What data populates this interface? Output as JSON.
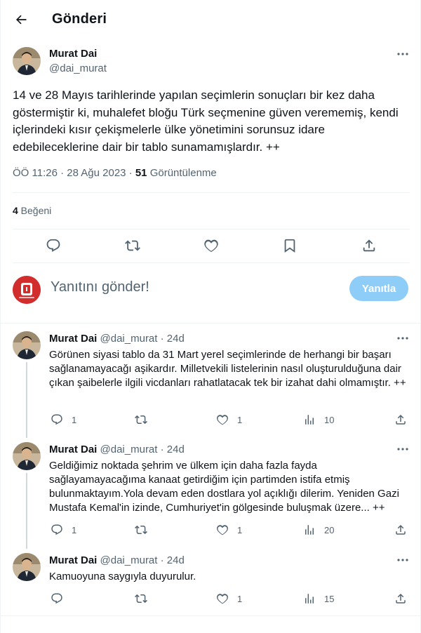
{
  "header": {
    "title": "Gönderi"
  },
  "main_post": {
    "name": "Murat Dai",
    "handle": "@dai_murat",
    "text": "14 ve 28 Mayıs tarihlerinde yapılan seçimlerin sonuçları bir kez daha göstermiştir ki, muhalefet bloğu Türk seçmenine güven verememiş, kendi içlerindeki kısır çekişmelerle ülke yönetimini sorunsuz idare edebileceklerine dair bir tablo sunamamışlardır. ++",
    "time": "ÖÖ 11:26 · 28 Ağu 2023 · ",
    "views_count": "51",
    "views_label": " Görüntülenme",
    "likes_count": "4",
    "likes_label": " Beğeni"
  },
  "reply_box": {
    "placeholder": "Yanıtını gönder!",
    "button_label": "Yanıtla"
  },
  "replies": [
    {
      "name": "Murat Dai",
      "handle": "@dai_murat · 24d",
      "text": "Görünen siyasi tablo da 31 Mart yerel seçimlerinde de herhangi bir başarı sağlanamayacağı aşikardır. Milletvekili listelerinin nasıl oluşturulduğuna dair çıkan şaibelerle ilgili vicdanları rahatlatacak tek bir izahat dahi olmamıştır. ++",
      "reply_count": "1",
      "retweet_count": "",
      "like_count": "1",
      "view_count": "10"
    },
    {
      "name": "Murat Dai",
      "handle": "@dai_murat · 24d",
      "text": "Geldiğimiz noktada şehrim ve ülkem için daha fazla fayda sağlayamayacağıma kanaat getirdiğim için partimden istifa etmiş bulunmaktayım.Yola devam eden dostlara yol açıklığı dilerim. Yeniden Gazi Mustafa Kemal'in izinde, Cumhuriyet'in gölgesinde buluşmak üzere... ++",
      "reply_count": "1",
      "retweet_count": "",
      "like_count": "1",
      "view_count": "20"
    },
    {
      "name": "Murat Dai",
      "handle": "@dai_murat · 24d",
      "text": "Kamuoyuna saygıyla duyurulur.",
      "reply_count": "",
      "retweet_count": "",
      "like_count": "1",
      "view_count": "15"
    }
  ],
  "colors": {
    "accent_disabled": "#8ecdf7",
    "secondary_text": "#536471",
    "reply_avatar_bg": "#d22d2d"
  },
  "icons": [
    "back-arrow-icon",
    "more-icon",
    "reply-icon",
    "retweet-icon",
    "like-icon",
    "bookmark-icon",
    "share-icon",
    "views-icon"
  ]
}
